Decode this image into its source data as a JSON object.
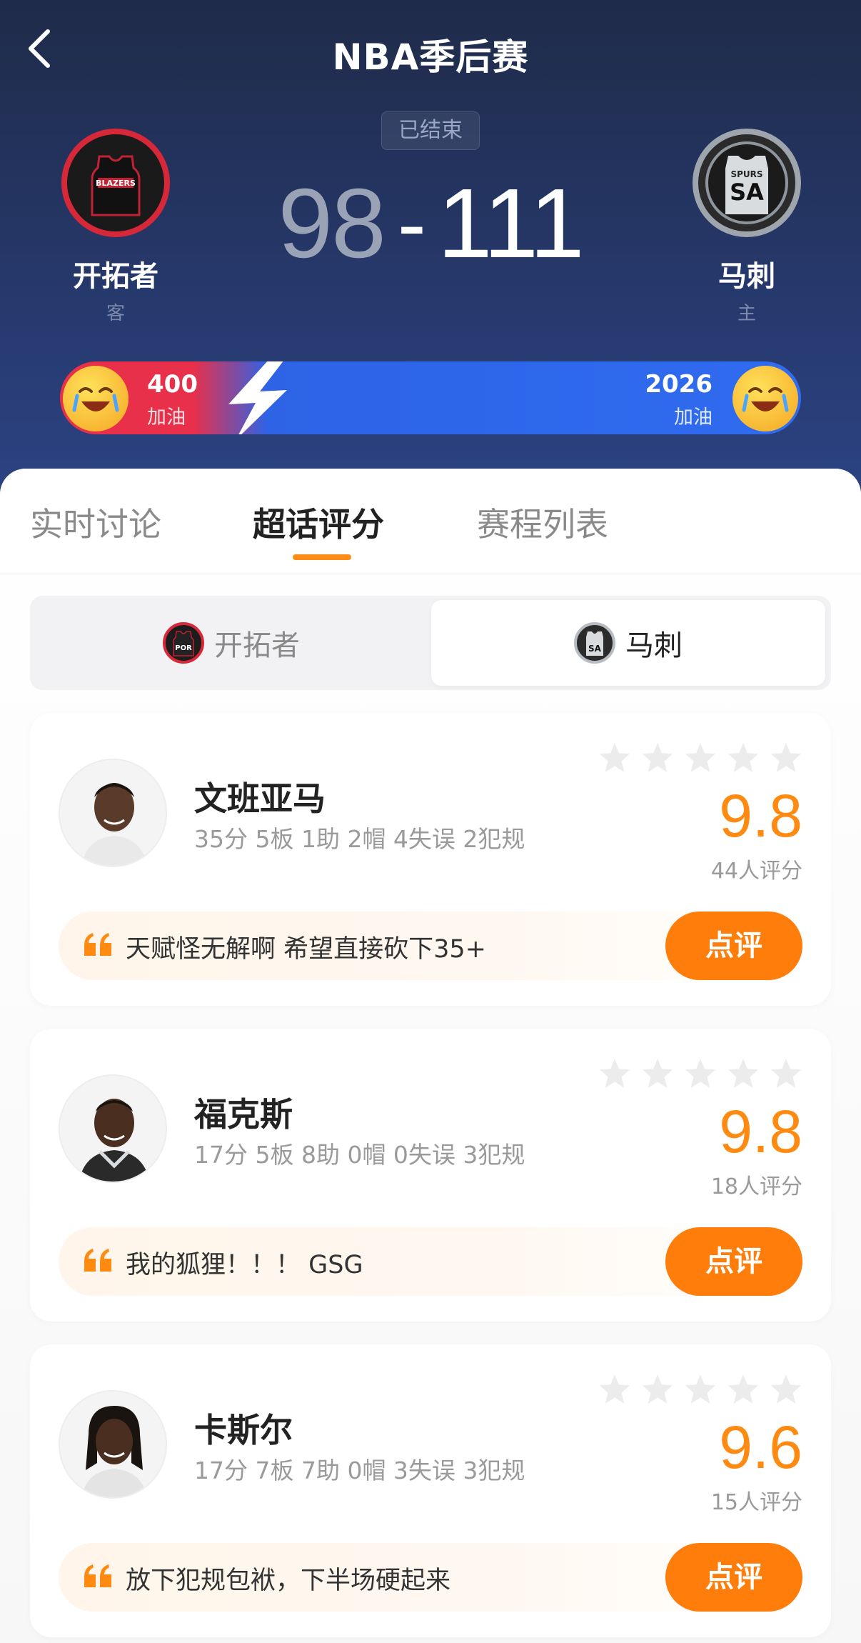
{
  "header": {
    "title": "NBA季后赛",
    "status": "已结束",
    "score_away": "98",
    "score_sep": "-",
    "score_home": "111",
    "away_team": {
      "name": "开拓者",
      "side": "客",
      "logo_text": "BLAZERS"
    },
    "home_team": {
      "name": "马刺",
      "side": "主",
      "logo_text": "SA",
      "logo_sub": "SPURS"
    }
  },
  "cheer": {
    "away_count": "400",
    "away_label": "加油",
    "home_count": "2026",
    "home_label": "加油"
  },
  "tabs": [
    {
      "label": "实时讨论"
    },
    {
      "label": "超话评分"
    },
    {
      "label": "赛程列表"
    }
  ],
  "team_switch": [
    {
      "label": "开拓者",
      "logo_text": "POR"
    },
    {
      "label": "马刺",
      "logo_text": "SA"
    }
  ],
  "players": [
    {
      "name": "文班亚马",
      "stats": "35分 5板 1助 2帽 4失误 2犯规",
      "rating": "9.8",
      "count": "44人评分",
      "comment": "天赋怪无解啊 希望直接砍下35+",
      "button": "点评"
    },
    {
      "name": "福克斯",
      "stats": "17分 5板 8助 0帽 0失误 3犯规",
      "rating": "9.8",
      "count": "18人评分",
      "comment": "我的狐狸！！！ GSG",
      "button": "点评"
    },
    {
      "name": "卡斯尔",
      "stats": "17分 7板 7助 0帽 3失误 3犯规",
      "rating": "9.6",
      "count": "15人评分",
      "comment": "放下犯规包袱，下半场硬起来",
      "button": "点评"
    }
  ],
  "colors": {
    "accent": "#ff7d0a",
    "away_red": "#d7283a",
    "home_blue": "#2f6cf0",
    "header_bg": "#26386a"
  }
}
